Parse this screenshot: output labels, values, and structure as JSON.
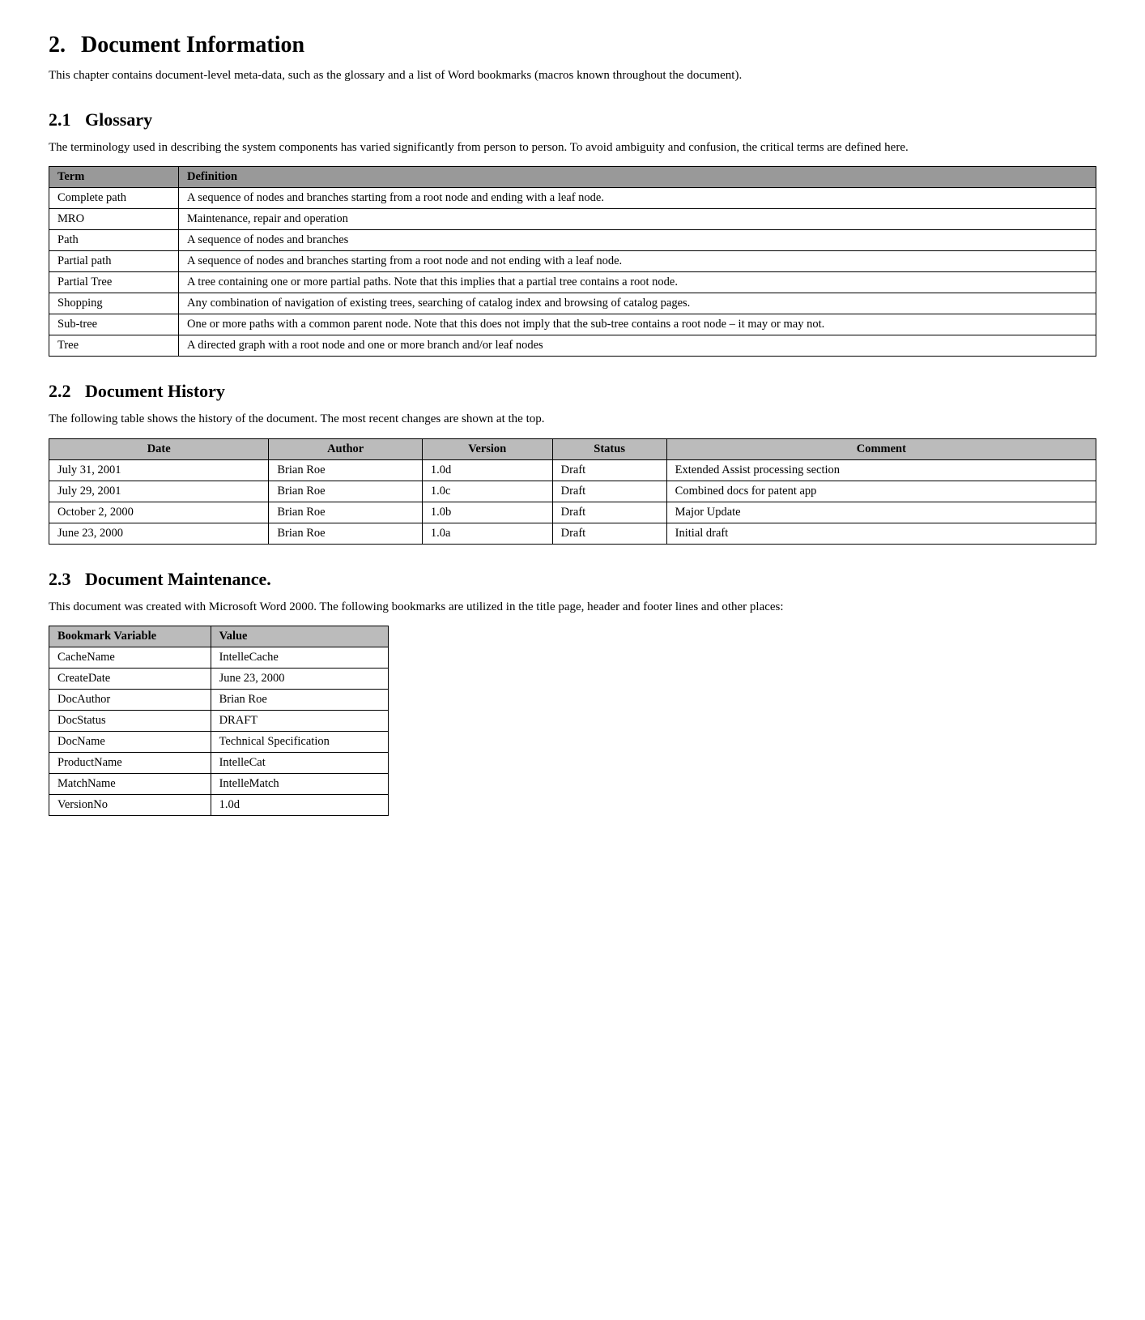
{
  "section2": {
    "title": "2.",
    "title_text": "Document Information",
    "intro": "This chapter contains document-level meta-data, such as the glossary and a list of Word bookmarks (macros known throughout the document).",
    "subsections": {
      "glossary": {
        "number": "2.1",
        "title": "Glossary",
        "intro": "The terminology used in describing the system components has varied significantly from person to person.  To avoid ambiguity and confusion, the critical terms are defined here.",
        "table": {
          "headers": [
            "Term",
            "Definition"
          ],
          "rows": [
            {
              "term": "Complete path",
              "definition": "A sequence of nodes and branches starting from a root node and ending with a leaf node."
            },
            {
              "term": "MRO",
              "definition": "Maintenance, repair and operation"
            },
            {
              "term": "Path",
              "definition": "A sequence of nodes and branches"
            },
            {
              "term": "Partial path",
              "definition": "A sequence of nodes and branches starting from a root node and not ending with a leaf node."
            },
            {
              "term": "Partial Tree",
              "definition": "A tree containing one or more partial paths.  Note that this implies that a partial tree contains a root node."
            },
            {
              "term": "Shopping",
              "definition": "Any combination of navigation of existing trees, searching of catalog index and browsing of catalog pages."
            },
            {
              "term": "Sub-tree",
              "definition": "One or more paths with a common parent node.  Note that this does not imply that the sub-tree contains a root node – it may or may not."
            },
            {
              "term": "Tree",
              "definition": "A directed graph with a root node and one or more branch and/or leaf nodes"
            }
          ]
        }
      },
      "history": {
        "number": "2.2",
        "title": "Document History",
        "intro": "The following table shows the history of the document.  The most recent changes are shown at the top.",
        "table": {
          "headers": [
            "Date",
            "Author",
            "Version",
            "Status",
            "Comment"
          ],
          "rows": [
            {
              "date": "July 31, 2001",
              "author": "Brian Roe",
              "version": "1.0d",
              "status": "Draft",
              "comment": "Extended Assist processing section"
            },
            {
              "date": "July 29, 2001",
              "author": "Brian Roe",
              "version": "1.0c",
              "status": "Draft",
              "comment": "Combined docs for patent app"
            },
            {
              "date": "October 2, 2000",
              "author": "Brian Roe",
              "version": "1.0b",
              "status": "Draft",
              "comment": "Major Update"
            },
            {
              "date": "June 23, 2000",
              "author": "Brian Roe",
              "version": "1.0a",
              "status": "Draft",
              "comment": "Initial draft"
            }
          ]
        }
      },
      "maintenance": {
        "number": "2.3",
        "title": "Document Maintenance.",
        "intro": "This document was created with Microsoft Word 2000. The following bookmarks are utilized in the title page, header and footer lines and other places:",
        "table": {
          "headers": [
            "Bookmark Variable",
            "Value"
          ],
          "rows": [
            {
              "variable": "CacheName",
              "value": "IntelleCache"
            },
            {
              "variable": "CreateDate",
              "value": "June 23, 2000"
            },
            {
              "variable": "DocAuthor",
              "value": "Brian Roe"
            },
            {
              "variable": "DocStatus",
              "value": "DRAFT"
            },
            {
              "variable": "DocName",
              "value": "Technical Specification"
            },
            {
              "variable": "ProductName",
              "value": "IntelleCat"
            },
            {
              "variable": "MatchName",
              "value": "IntelleMatch"
            },
            {
              "variable": "VersionNo",
              "value": "1.0d"
            }
          ]
        }
      }
    }
  }
}
